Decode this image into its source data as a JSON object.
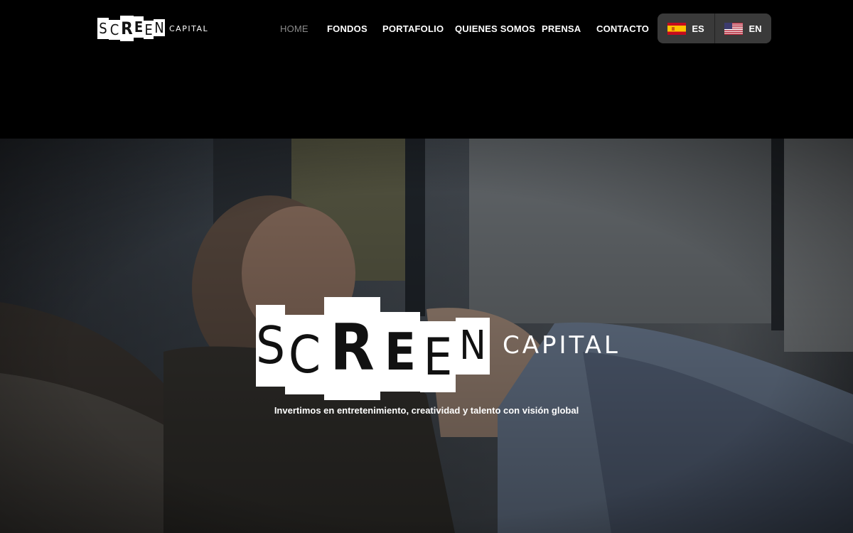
{
  "brand": {
    "logo_letters": [
      "S",
      "C",
      "R",
      "E",
      "E",
      "N"
    ],
    "logo_suffix": "CAPITAL"
  },
  "nav": {
    "items": [
      {
        "label": "HOME",
        "active": true
      },
      {
        "label": "FONDOS"
      },
      {
        "label": "PORTAFOLIO"
      },
      {
        "label": "QUIENES SOMOS"
      },
      {
        "label": "PRENSA"
      },
      {
        "label": "CONTACTO"
      }
    ]
  },
  "language": {
    "options": [
      {
        "code": "ES",
        "flag": "spain-flag-icon"
      },
      {
        "code": "EN",
        "flag": "usa-flag-icon"
      }
    ]
  },
  "hero": {
    "logo_letters": [
      "S",
      "C",
      "R",
      "E",
      "E",
      "N"
    ],
    "logo_suffix": "CAPITAL",
    "tagline": "Invertimos en entretenimiento, creatividad y talento con visión global"
  },
  "colors": {
    "header_bg": "#000000",
    "nav_active": "#8a8a8a",
    "lang_switcher_bg": "#3a3a3a"
  }
}
